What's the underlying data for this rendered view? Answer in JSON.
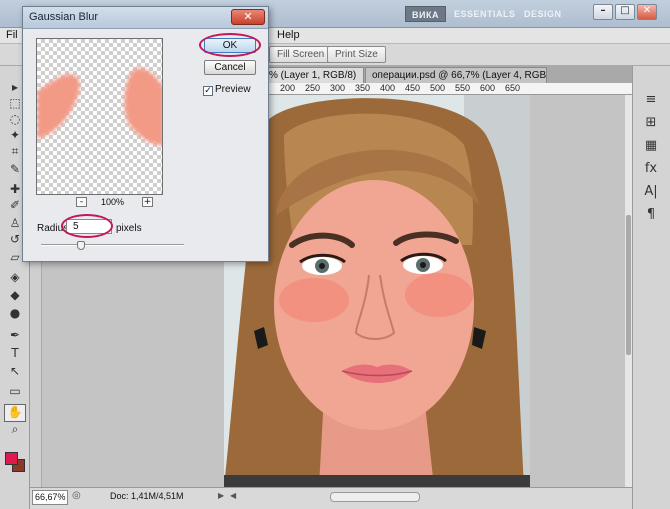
{
  "app": {
    "workspaces": [
      "ВИКА",
      "ESSENTIALS",
      "DESIGN"
    ],
    "window_buttons": [
      "minimize",
      "restore",
      "close"
    ]
  },
  "menubar": {
    "left_item": "Fil",
    "right_item": "Help"
  },
  "optionsbar": {
    "fill_screen": "Fill Screen",
    "print_size": "Print Size"
  },
  "tabs": [
    {
      "label": "% (Layer 1, RGB/8)",
      "close": "×"
    },
    {
      "label": "операции.psd @ 66,7% (Layer 4, RGB/8) *"
    }
  ],
  "ruler": {
    "ticks": [
      "200",
      "250",
      "300",
      "350",
      "400",
      "450",
      "500",
      "550",
      "600",
      "650"
    ]
  },
  "dialog": {
    "title": "Gaussian Blur",
    "close": "✕",
    "ok": "OK",
    "cancel": "Cancel",
    "preview_label": "Preview",
    "preview_checked": true,
    "preview_checkmark": "✓",
    "zoom_minus": "-",
    "zoom_plus": "+",
    "zoom_level": "100%",
    "radius_label": "Radius:",
    "radius_value": "5",
    "radius_unit": "pixels"
  },
  "statusbar": {
    "zoom": "66,67%",
    "doc_info": "Doc: 1,41M/4,51M",
    "arrow_left": "◀",
    "arrow_right": "▶"
  },
  "colors": {
    "foreground": "#e01a4f",
    "background": "#8b3a2a",
    "highlight": "#c2185b",
    "skin_tone": "#f2a08e"
  },
  "tools": [
    {
      "name": "move-tool-icon",
      "glyph": "▸"
    },
    {
      "name": "marquee-tool-icon",
      "glyph": "⬚"
    },
    {
      "name": "lasso-tool-icon",
      "glyph": "◌"
    },
    {
      "name": "quick-select-tool-icon",
      "glyph": "✦"
    },
    {
      "name": "crop-tool-icon",
      "glyph": "⌗"
    },
    {
      "name": "eyedropper-tool-icon",
      "glyph": "✎"
    },
    {
      "name": "healing-tool-icon",
      "glyph": "✚"
    },
    {
      "name": "brush-tool-icon",
      "glyph": "✐"
    },
    {
      "name": "stamp-tool-icon",
      "glyph": "♙"
    },
    {
      "name": "history-brush-tool-icon",
      "glyph": "↺"
    },
    {
      "name": "eraser-tool-icon",
      "glyph": "▱"
    },
    {
      "name": "bucket-tool-icon",
      "glyph": "◈"
    },
    {
      "name": "blur-tool-icon",
      "glyph": "◆"
    },
    {
      "name": "dodge-tool-icon",
      "glyph": "●"
    },
    {
      "name": "pen-tool-icon",
      "glyph": "✒"
    },
    {
      "name": "type-tool-icon",
      "glyph": "T"
    },
    {
      "name": "path-select-tool-icon",
      "glyph": "↖"
    },
    {
      "name": "shape-tool-icon",
      "glyph": "▭"
    },
    {
      "name": "hand-tool-icon",
      "glyph": "✋"
    },
    {
      "name": "zoom-tool-icon",
      "glyph": "⌕"
    }
  ],
  "panel_icons": [
    "≡",
    "⊞",
    "▦",
    "fx",
    "A|",
    "¶"
  ]
}
